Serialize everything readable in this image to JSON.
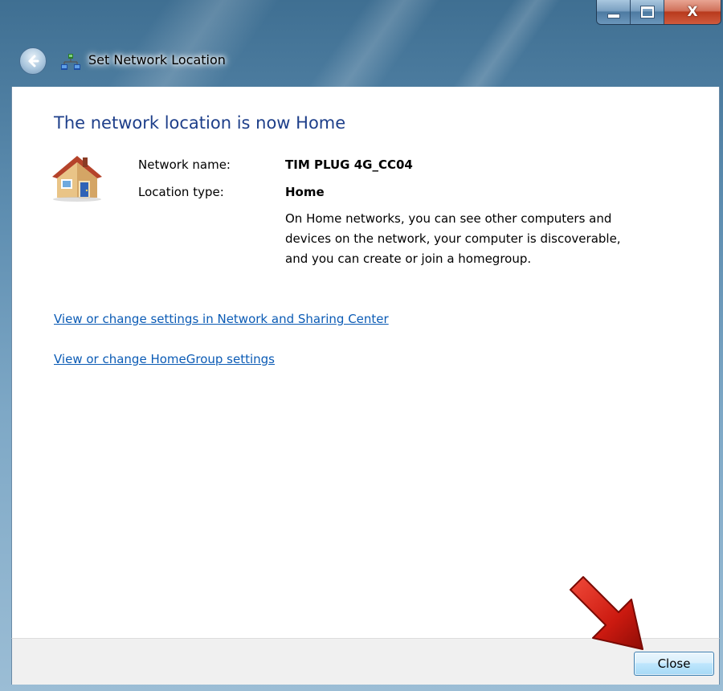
{
  "window": {
    "title": "Set Network Location",
    "caption": {
      "minimize_icon": "minimize-icon",
      "maximize_icon": "maximize-icon",
      "close_glyph": "X"
    }
  },
  "nav": {
    "back_icon": "back-arrow-icon",
    "title_icon": "network-icon"
  },
  "main": {
    "heading": "The network location is now Home",
    "icon": "house-icon",
    "network_name_label": "Network name:",
    "network_name_value": "TIM PLUG 4G_CC04",
    "location_type_label": "Location type:",
    "location_type_value": "Home",
    "description": "On Home networks, you can see other computers and devices on the network, your computer is discoverable, and you can create or join a homegroup.",
    "links": [
      "View or change settings in Network and Sharing Center",
      "View or change HomeGroup settings"
    ]
  },
  "footer": {
    "close_label": "Close"
  },
  "annotation": {
    "arrow_icon": "red-arrow-icon",
    "arrow_color": "#cc1a10"
  },
  "colors": {
    "heading": "#1e3f8a",
    "link": "#0b5bb5",
    "title_glass": "#5d8db0"
  }
}
